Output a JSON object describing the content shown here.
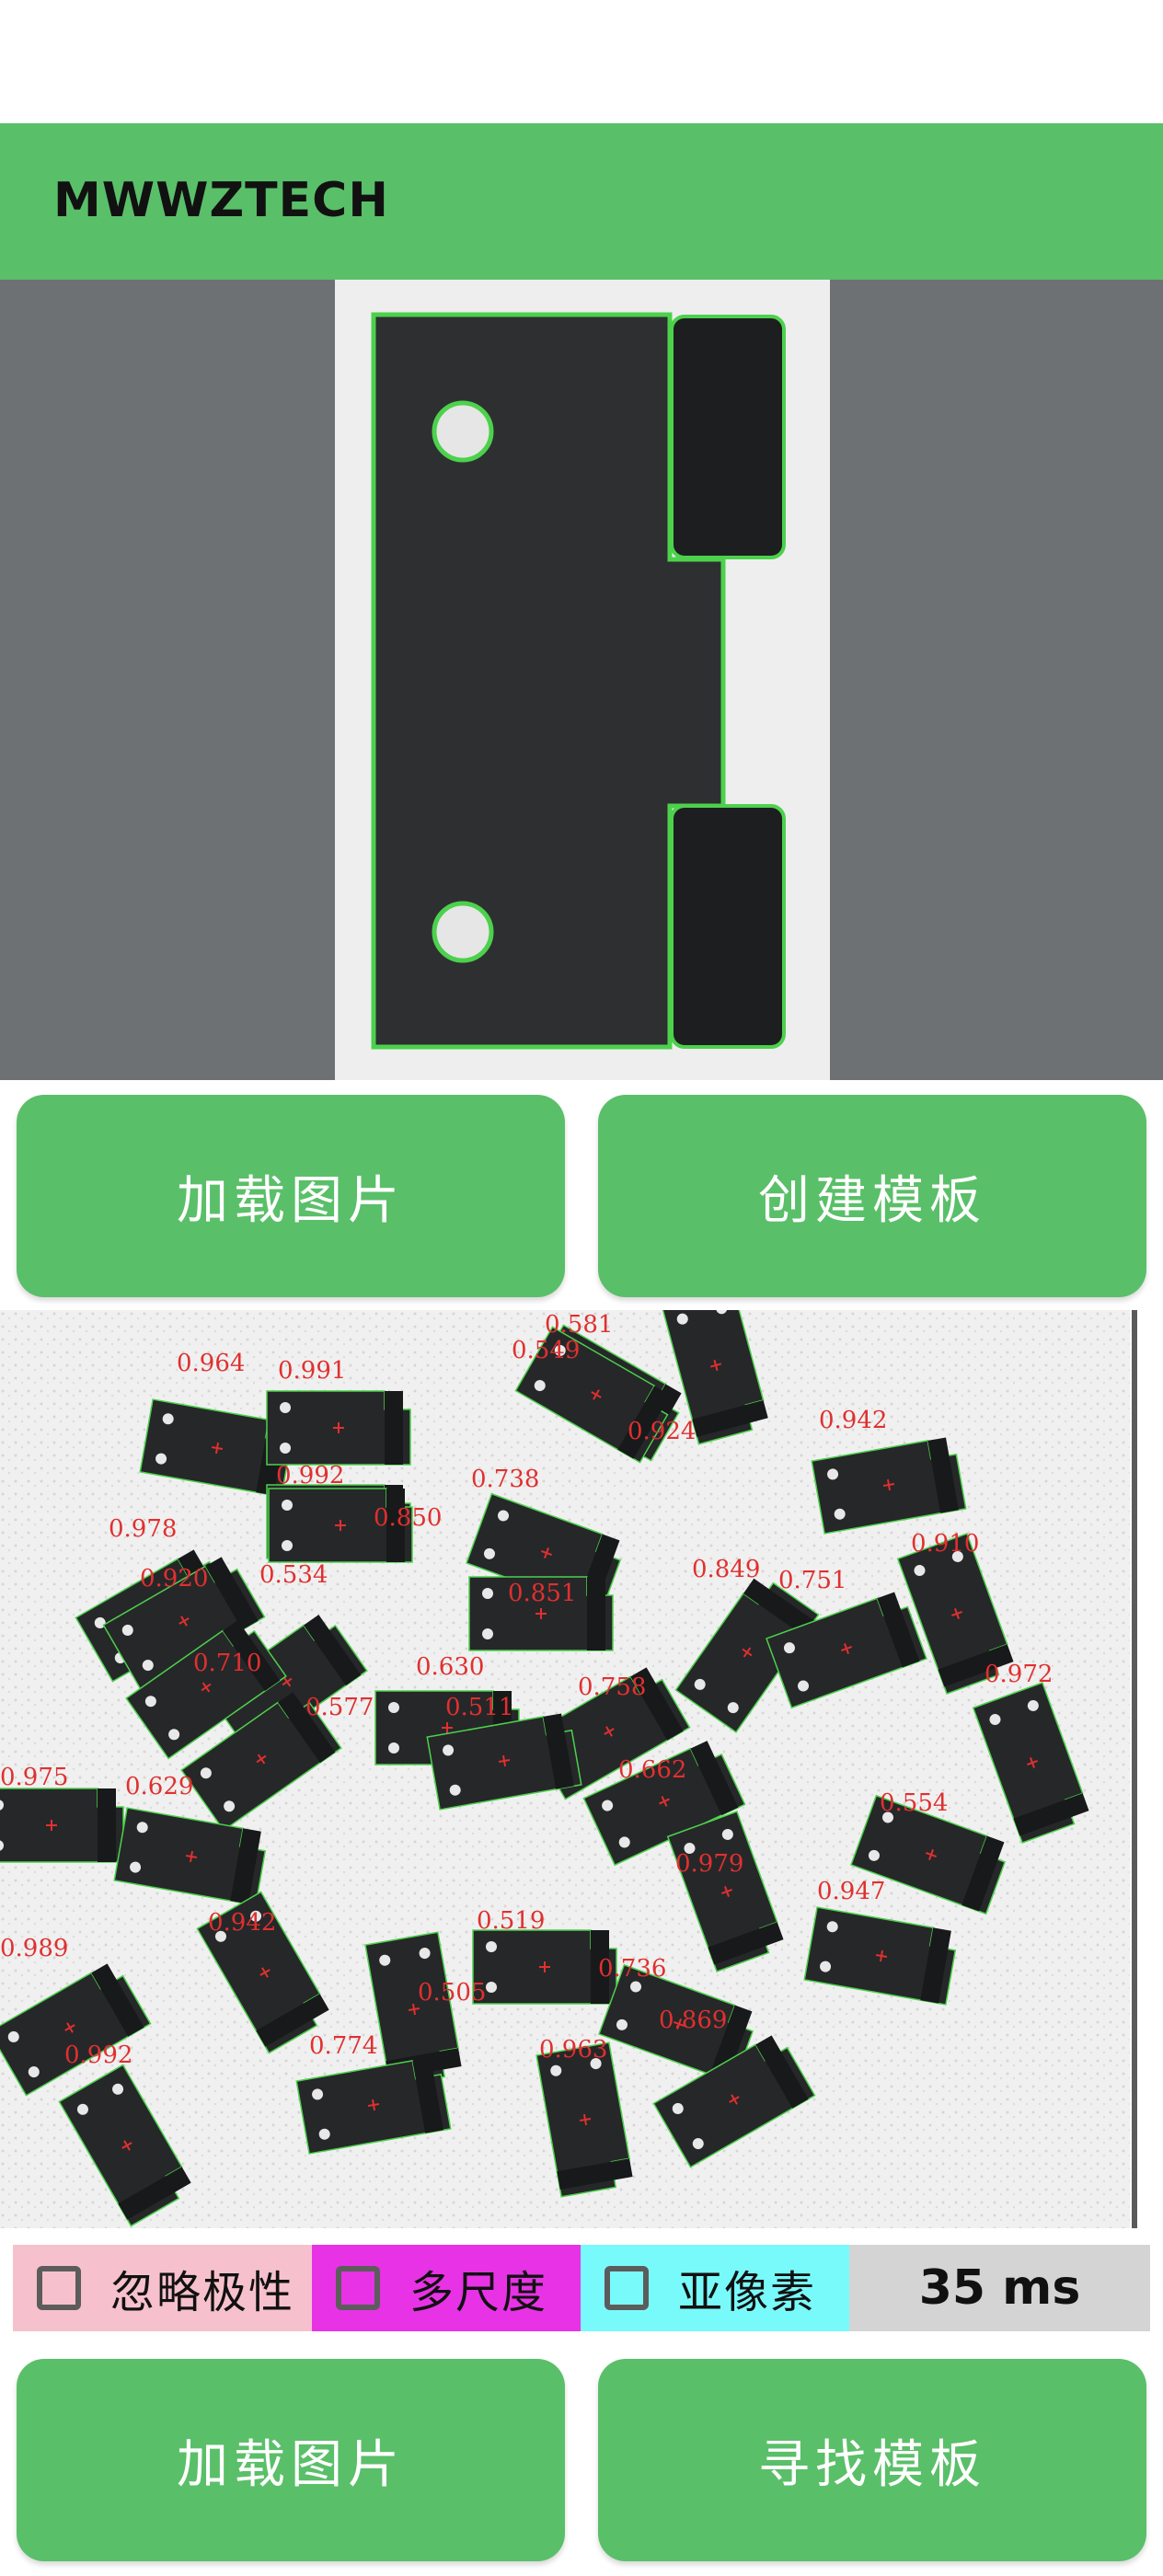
{
  "app": {
    "title": "MWWZTECH"
  },
  "top_buttons": {
    "load_image": "加载图片",
    "create_template": "创建模板"
  },
  "bottom_buttons": {
    "load_image": "加载图片",
    "find_template": "寻找模板"
  },
  "options": {
    "ignore_polarity": {
      "label": "忽略极性",
      "checked": false,
      "color": "#f6c1cc"
    },
    "multi_scale": {
      "label": "多尺度",
      "checked": false,
      "color": "#e832e6"
    },
    "subpixel": {
      "label": "亚像素",
      "checked": false,
      "color": "#79fafa"
    }
  },
  "timing": {
    "text": "35 ms"
  },
  "colors": {
    "accent": "#5abf69",
    "match_outline": "#4cd14c",
    "score_text": "#e03030"
  },
  "match_scores": [
    "0.581",
    "0.549",
    "0.964",
    "0.991",
    "0.924",
    "0.942",
    "0.992",
    "0.738",
    "0.850",
    "0.978",
    "0.920",
    "0.534",
    "0.851",
    "0.849",
    "0.751",
    "0.910",
    "0.710",
    "0.630",
    "0.758",
    "0.972",
    "0.577",
    "0.511",
    "0.975",
    "0.629",
    "0.662",
    "0.554",
    "0.979",
    "0.942",
    "0.947",
    "0.989",
    "0.519",
    "0.736",
    "0.505",
    "0.869",
    "0.992",
    "0.774",
    "0.963"
  ]
}
